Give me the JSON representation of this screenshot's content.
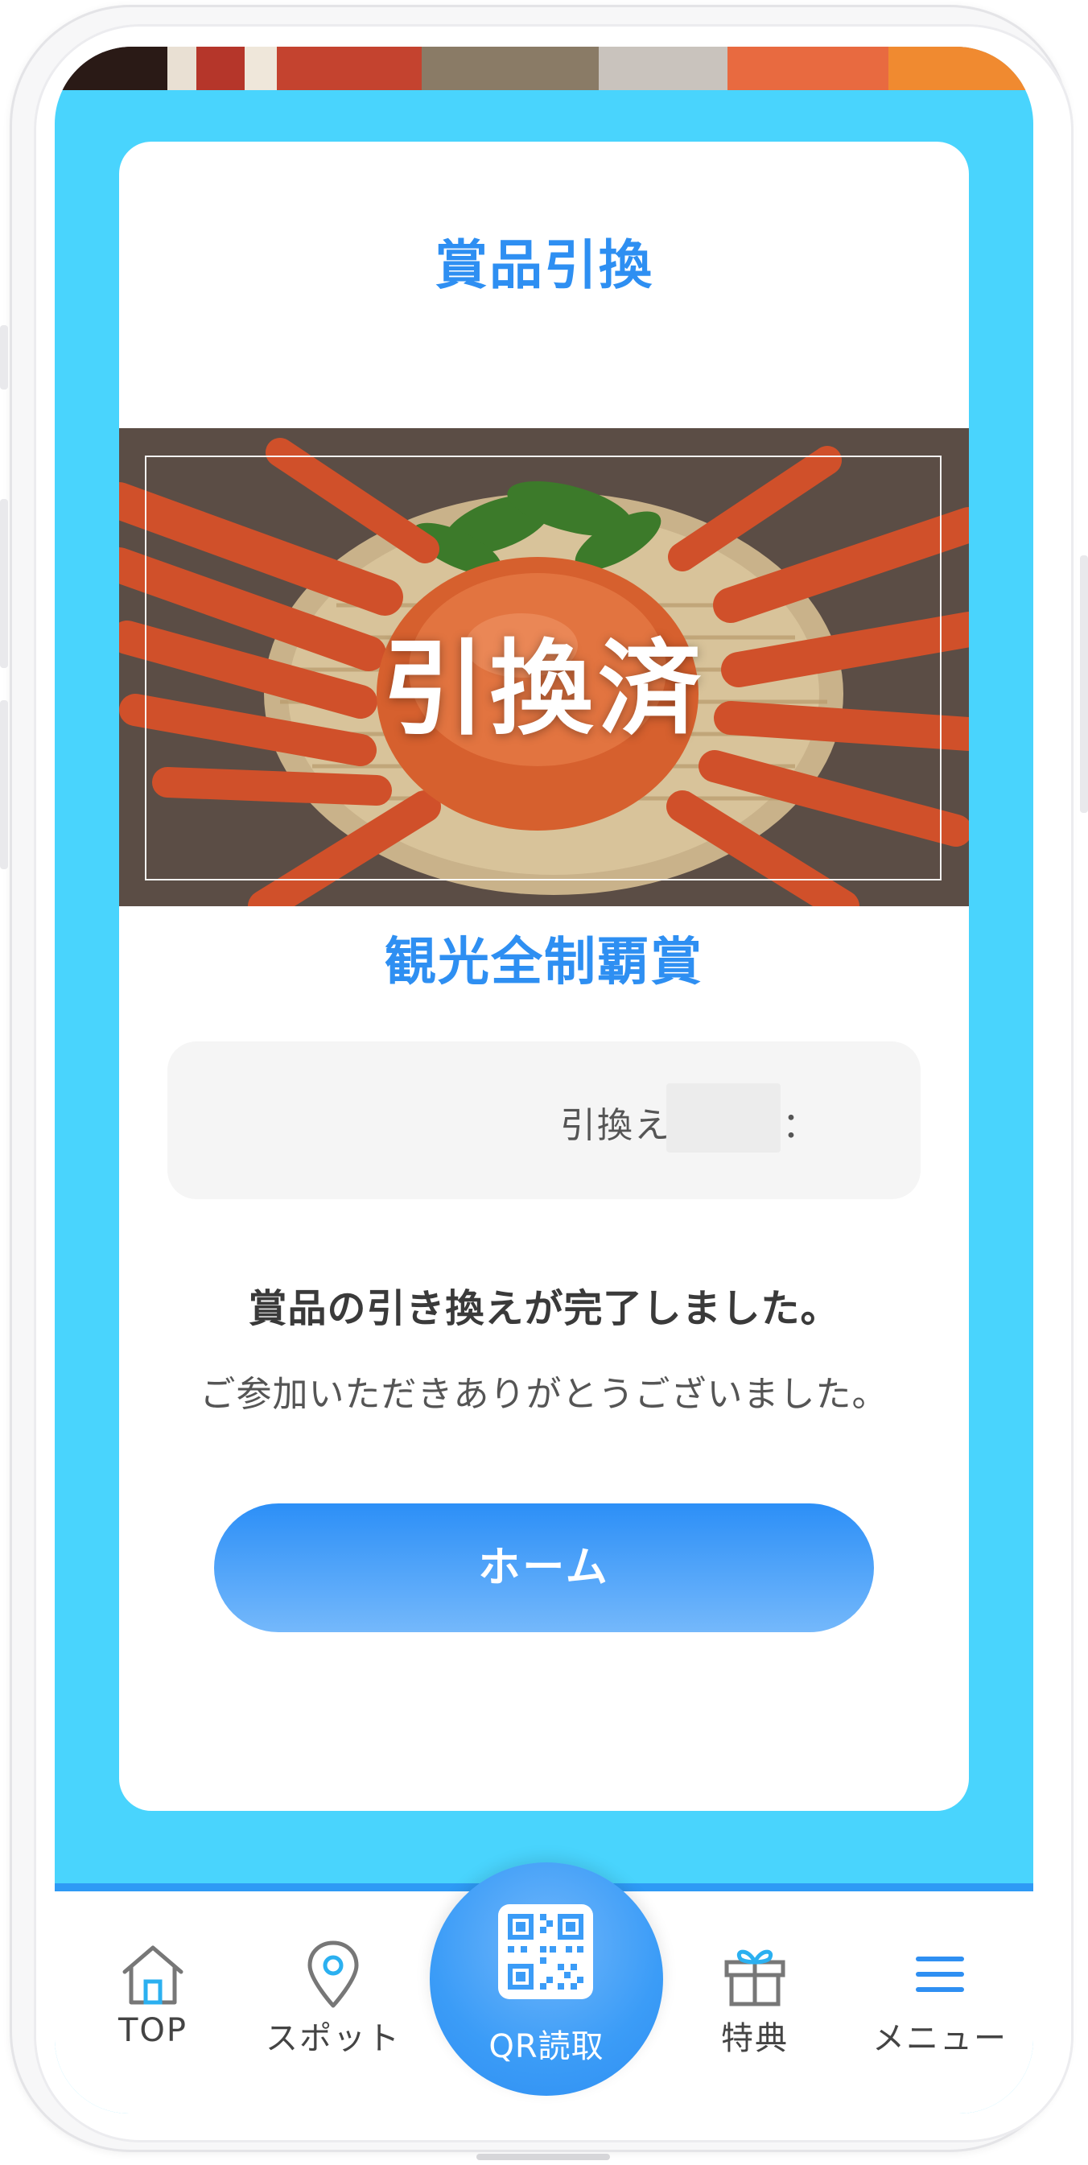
{
  "card": {
    "title": "賞品引換",
    "status_stamp": "引換済",
    "prize_name": "観光全制覇賞",
    "code_label": "引換えコード：",
    "code_value": "",
    "done_message": "賞品の引き換えが完了しました。",
    "thanks_message": "ご参加いただきありがとうございました。",
    "home_button": "ホーム"
  },
  "bottom_nav": {
    "items": [
      {
        "label": "TOP",
        "icon": "home-icon"
      },
      {
        "label": "スポット",
        "icon": "map-pin-icon"
      },
      {
        "label": "QR読取",
        "icon": "qr-code-icon"
      },
      {
        "label": "特典",
        "icon": "gift-icon"
      },
      {
        "label": "メニュー",
        "icon": "hamburger-menu-icon"
      }
    ]
  },
  "colors": {
    "background": "#49d4fd",
    "accent": "#2e8ff2",
    "nav_line": "#2e9af5"
  }
}
